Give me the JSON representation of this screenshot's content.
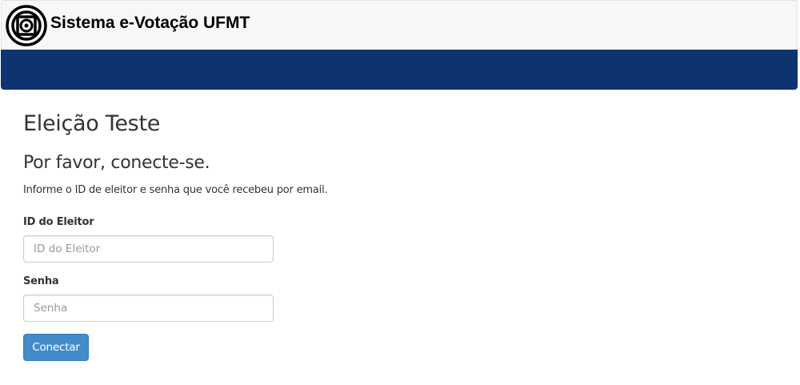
{
  "header": {
    "brand_title": "Sistema e-Votação UFMT",
    "logo_icon": "ufmt-concentric-logo-icon",
    "background_color": "#f7f7f7"
  },
  "navbar": {
    "background_color": "#0d3370"
  },
  "main": {
    "election_title": "Eleição Teste",
    "login_heading": "Por favor, conecte-se.",
    "instructions": "Informe o ID de eleitor e senha que você recebeu por email.",
    "voter_id": {
      "label": "ID do Eleitor",
      "placeholder": "ID do Eleitor",
      "value": ""
    },
    "password": {
      "label": "Senha",
      "placeholder": "Senha",
      "value": ""
    },
    "submit_label": "Conectar",
    "accent_color": "#428bca"
  }
}
